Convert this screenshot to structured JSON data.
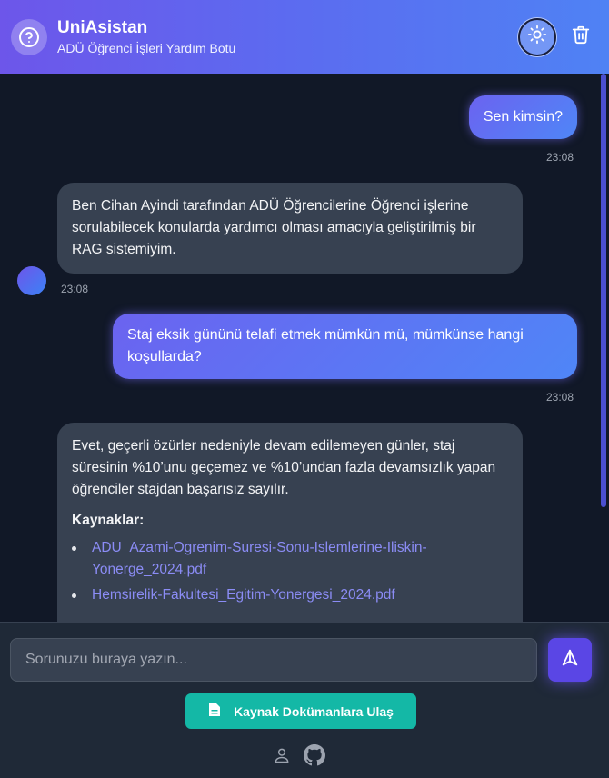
{
  "header": {
    "title": "UniAsistan",
    "subtitle": "ADÜ Öğrenci İşleri Yardım Botu",
    "logo_icon": "question-circle-icon",
    "theme_icon": "sun-icon",
    "clear_icon": "trash-icon"
  },
  "messages": [
    {
      "role": "user",
      "text": "Sen kimsin?",
      "time": "23:08"
    },
    {
      "role": "bot",
      "text": "Ben Cihan Ayindi tarafından ADÜ Öğrencilerine Öğrenci işlerine sorulabilecek konularda yardımcı olması amacıyla geliştirilmiş bir RAG sistemiyim.",
      "time": "23:08"
    },
    {
      "role": "user",
      "text": "Staj eksik gününü telafi etmek mümkün mü, mümkünse hangi koşullarda?",
      "time": "23:08"
    },
    {
      "role": "bot",
      "text": "Evet, geçerli özürler nedeniyle devam edilemeyen günler, staj süresinin %10’unu geçemez ve %10’undan fazla devamsızlık yapan öğrenciler stajdan başarısız sayılır.",
      "sources_label": "Kaynaklar:",
      "sources": [
        "ADU_Azami-Ogrenim-Suresi-Sonu-Islemlerine-Iliskin-Yonerge_2024.pdf",
        "Hemsirelik-Fakultesi_Egitim-Yonergesi_2024.pdf"
      ]
    }
  ],
  "composer": {
    "placeholder": "Sorunuzu buraya yazın...",
    "send_icon": "send-icon"
  },
  "footer": {
    "docs_button_label": "Kaynak Dokümanlara Ulaş",
    "docs_icon": "document-icon",
    "profile_icon": "user-icon",
    "github_icon": "github-icon"
  },
  "colors": {
    "accent": "#5b6cf0",
    "teal": "#14b8a6",
    "background": "#111827",
    "bot_bubble": "#374151",
    "link": "#8b8cf5"
  }
}
